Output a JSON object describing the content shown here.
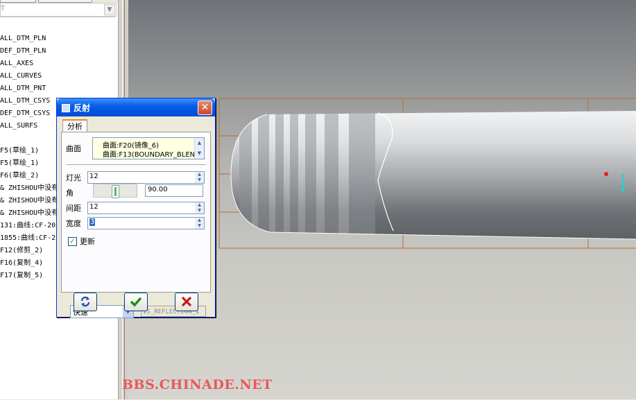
{
  "left_panel": {
    "filter_value": "T",
    "tree_items": [
      "ALL_DTM_PLN",
      "DEF_DTM_PLN",
      "ALL_AXES",
      "ALL_CURVES",
      "ALL_DTM_PNT",
      "ALL_DTM_CSYS",
      "DEF_DTM_CSYS",
      "ALL_SURFS",
      "",
      "F5(草绘_1)",
      "F5(草绘_1)",
      "F6(草绘_2)",
      "& ZHISHOU中没有",
      "& ZHISHOU中没有",
      "& ZHISHOU中没有",
      "131:曲线:CF-20",
      "1855:曲线:CF-2",
      "F12(修剪_2)",
      "F16(复制_4)",
      "F17(复制_5)"
    ]
  },
  "dialog": {
    "title": "反射",
    "tab_label": "分析",
    "surface_label": "曲面",
    "surfaces": [
      "曲面:F20(镜像_6)",
      "曲面:F13(BOUNDARY_BLEN"
    ],
    "light_label": "灯光",
    "light_value": "12",
    "angle_label": "角",
    "angle_value": "90.00",
    "angle_slider_fraction": 0.5,
    "spacing_label": "间距",
    "spacing_value": "12",
    "width_label": "宽度",
    "width_value": "3",
    "update_label": "更新",
    "update_checked": true,
    "mode_value": "快速",
    "result_name": "IS_REFLECTION_1"
  },
  "watermark": "BBS.CHINADE.NET",
  "colors": {
    "title_bar": "#0054e3",
    "watermark": "#e8585c",
    "datum_lines": "#b86a3a"
  }
}
